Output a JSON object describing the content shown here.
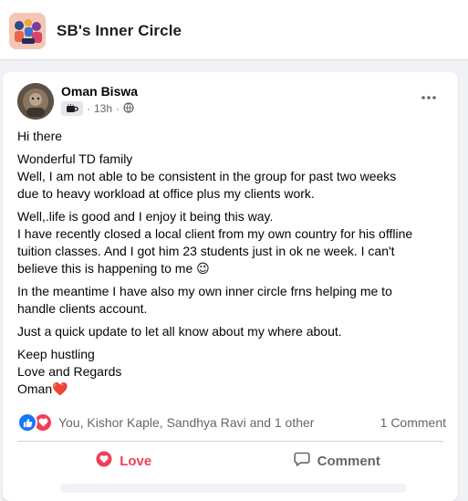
{
  "group": {
    "name": "SB's Inner Circle"
  },
  "post": {
    "author": "Oman Biswa",
    "time": "13h",
    "dot": "·",
    "paragraphs": [
      [
        "Hi there"
      ],
      [
        "Wonderful TD family",
        "Well, I am not able to be consistent in the group for past two weeks",
        "due to heavy workload at office plus my clients work."
      ],
      [
        "Well,.life is good and I enjoy it being this way.",
        "I have recently closed a local client from my own country for his offline",
        "tuition classes. And I got him 23 students just in ok ne week. I can't",
        "believe this is happening to me 😉"
      ],
      [
        "In the meantime I have also my own inner circle frns helping me to",
        "handle clients account."
      ],
      [
        "Just a quick update to let all know about my where about."
      ],
      [
        "Keep hustling",
        "Love and Regards",
        "Oman❤️"
      ]
    ],
    "reactions_text": "You, Kishor Kaple, Sandhya Ravi and 1 other",
    "comments_text": "1 Comment",
    "love_label": "Love",
    "comment_label": "Comment"
  },
  "icons": {
    "more": "more-dots-icon",
    "badge": "coffee-badge-icon",
    "audience": "globe-icon",
    "like_reaction": "like-reaction-icon",
    "love_reaction": "love-reaction-icon",
    "love_action": "heart-icon",
    "comment_action": "comment-bubble-icon"
  },
  "colors": {
    "like": "#1877f2",
    "love": "#f33e58",
    "secondary_text": "#65676b"
  }
}
